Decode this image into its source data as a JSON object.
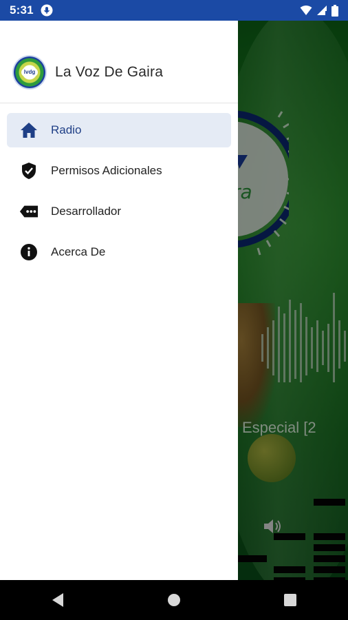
{
  "status_bar": {
    "time": "5:31",
    "icons": [
      "mic-icon",
      "wifi-icon",
      "signal-icon",
      "battery-icon"
    ]
  },
  "drawer": {
    "app_name": "La Voz De Gaira",
    "logo_text": "lvdg",
    "items": [
      {
        "label": "Radio",
        "icon": "home-icon",
        "active": true
      },
      {
        "label": "Permisos Adicionales",
        "icon": "shield-check-icon",
        "active": false
      },
      {
        "label": "Desarrollador",
        "icon": "tag-dots-icon",
        "active": false
      },
      {
        "label": "Acerca De",
        "icon": "info-icon",
        "active": false
      }
    ]
  },
  "background_app": {
    "track_title": "Especial [2",
    "icons": [
      "volume-icon"
    ]
  },
  "nav_bar": {
    "buttons": [
      "back-icon",
      "home-circle-icon",
      "recents-icon"
    ]
  },
  "colors": {
    "status_bar": "#1b4aa5",
    "active_item_bg": "#e5ebf5",
    "active_text": "#1f3f86",
    "icon_active": "#1f3f86",
    "icon_default": "#111111"
  }
}
